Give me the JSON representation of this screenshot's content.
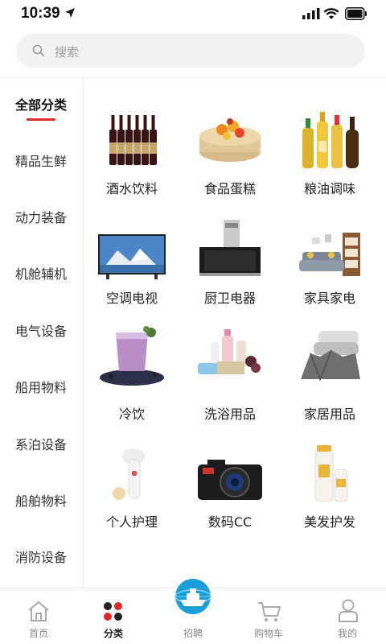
{
  "status": {
    "time": "10:39"
  },
  "search": {
    "placeholder": "搜索"
  },
  "sidebar": {
    "items": [
      {
        "label": "全部分类",
        "active": true
      },
      {
        "label": "精品生鲜"
      },
      {
        "label": "动力装备"
      },
      {
        "label": "机舱辅机"
      },
      {
        "label": "电气设备"
      },
      {
        "label": "船用物料"
      },
      {
        "label": "系泊设备"
      },
      {
        "label": "船舶物料"
      },
      {
        "label": "消防设备"
      }
    ]
  },
  "categories": [
    {
      "label": "酒水饮料",
      "icon": "wine-bottles-icon"
    },
    {
      "label": "食品蛋糕",
      "icon": "cake-icon"
    },
    {
      "label": "粮油调味",
      "icon": "oil-bottles-icon"
    },
    {
      "label": "空调电视",
      "icon": "tv-icon"
    },
    {
      "label": "厨卫电器",
      "icon": "range-hood-icon"
    },
    {
      "label": "家具家电",
      "icon": "sofa-icon"
    },
    {
      "label": "冷饮",
      "icon": "smoothie-icon"
    },
    {
      "label": "洗浴用品",
      "icon": "bath-products-icon"
    },
    {
      "label": "家居用品",
      "icon": "blanket-icon"
    },
    {
      "label": "个人护理",
      "icon": "face-brush-icon"
    },
    {
      "label": "数码CC",
      "icon": "camera-icon"
    },
    {
      "label": "美发护发",
      "icon": "shampoo-icon"
    }
  ],
  "bottom_nav": {
    "tabs": [
      {
        "label": "首页",
        "icon": "home-icon"
      },
      {
        "label": "分类",
        "icon": "category-icon",
        "active": true
      },
      {
        "label": "招聘",
        "icon": "ship-globe-icon"
      },
      {
        "label": "购物车",
        "icon": "cart-icon"
      },
      {
        "label": "我的",
        "icon": "user-icon"
      }
    ]
  },
  "colors": {
    "accent": "#e02a2a",
    "search_bg": "#f2f2f2",
    "ship_blue": "#1aa0d8"
  }
}
